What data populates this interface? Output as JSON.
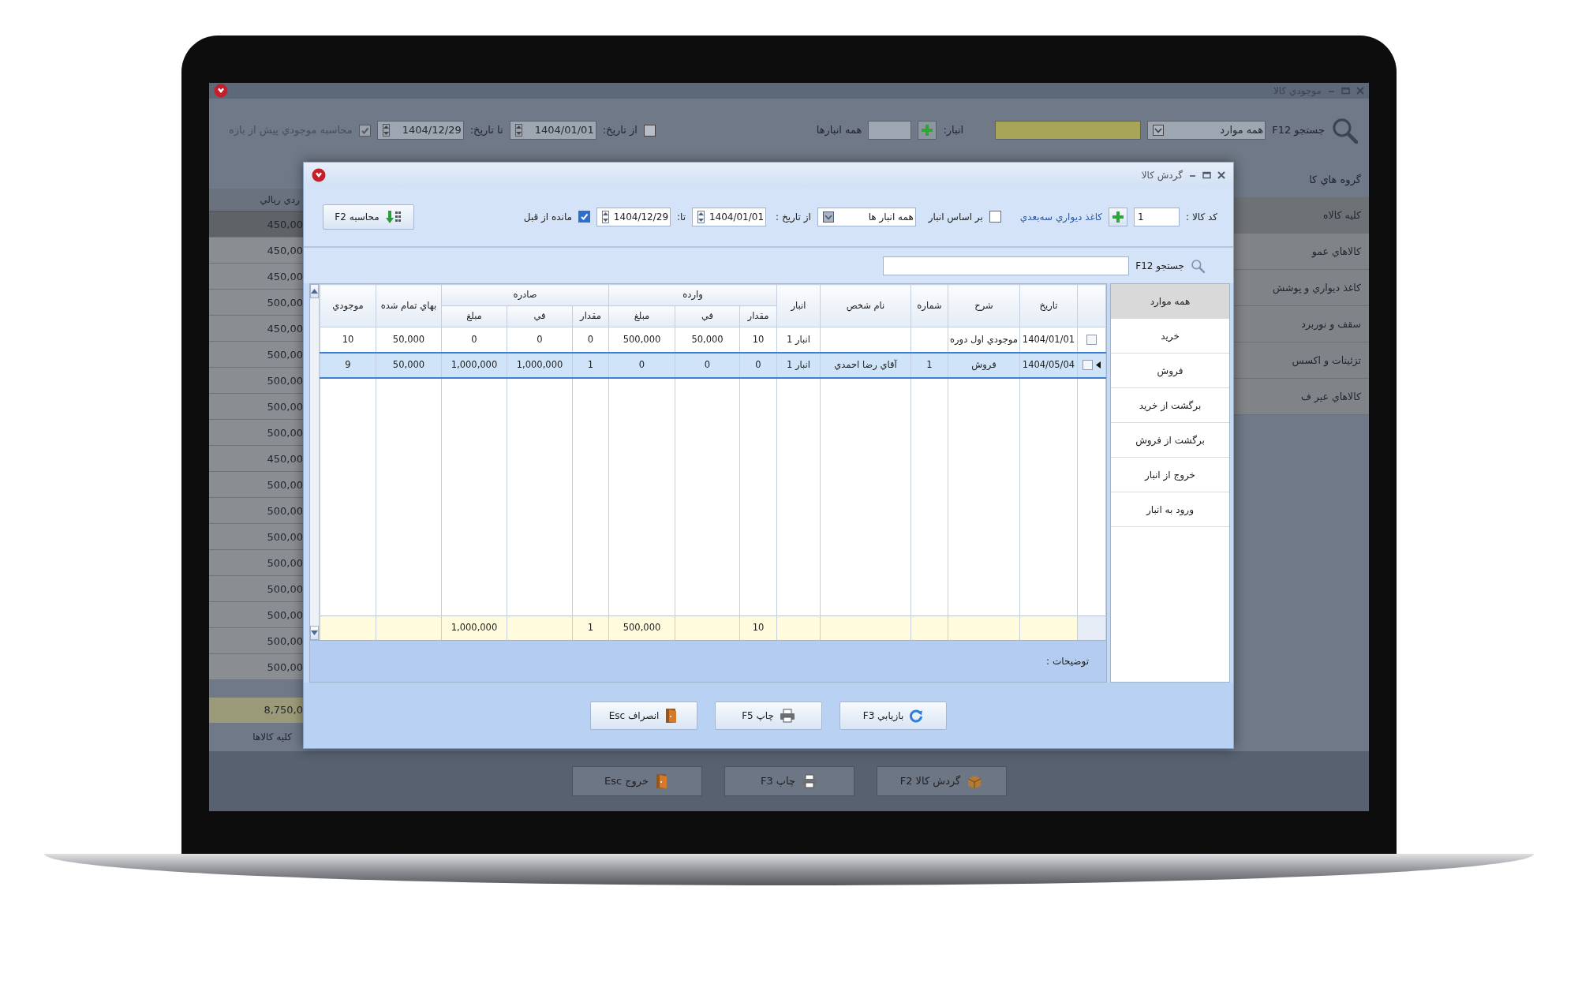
{
  "background_window": {
    "title": "موجودي كالا",
    "toolbar": {
      "search_label": "جستجو F12",
      "category": "همه موارد",
      "warehouse_label": "انبار:",
      "warehouse_name": "همه انبارها",
      "from_date_checked": false,
      "from_date_label": "از تاريخ:",
      "from_date": "1404/01/01",
      "to_date_label": "تا تاريخ:",
      "to_date": "1404/12/29",
      "prior_balance_checked": true,
      "prior_balance_label": "محاسبه موجودي پيش از بازه"
    },
    "value_column": {
      "header": "ردي ريالي",
      "rows": [
        {
          "value": "450,00",
          "selected": true
        },
        {
          "value": "450,00",
          "selected": false
        },
        {
          "value": "450,00",
          "selected": false
        },
        {
          "value": "500,00",
          "selected": false
        },
        {
          "value": "450,00",
          "selected": false
        },
        {
          "value": "500,00",
          "selected": false
        },
        {
          "value": "500,00",
          "selected": false
        },
        {
          "value": "500,00",
          "selected": false
        },
        {
          "value": "500,00",
          "selected": false
        },
        {
          "value": "450,00",
          "selected": false
        },
        {
          "value": "500,00",
          "selected": false
        },
        {
          "value": "500,00",
          "selected": false
        },
        {
          "value": "500,00",
          "selected": false
        },
        {
          "value": "500,00",
          "selected": false
        },
        {
          "value": "500,00",
          "selected": false
        },
        {
          "value": "500,00",
          "selected": false
        },
        {
          "value": "500,00",
          "selected": false
        },
        {
          "value": "500,00",
          "selected": false
        }
      ],
      "total": "8,750,0",
      "footer": "كليه كالاها"
    },
    "groups": {
      "header": "گروه هاي كا",
      "items": [
        {
          "label": "كليه كالاه",
          "selected": true
        },
        {
          "label": "كالاهاي عمو",
          "selected": false
        },
        {
          "label": "كاغذ ديواري و پوشش",
          "selected": false
        },
        {
          "label": "سقف و نوربرد",
          "selected": false
        },
        {
          "label": "تزئينات و اكسس",
          "selected": false
        },
        {
          "label": "كالاهاي عير ف",
          "selected": false
        }
      ]
    },
    "buttons": [
      {
        "label": "گردش كالا F2",
        "kind": "box"
      },
      {
        "label": "چاپ F3",
        "kind": "printer"
      },
      {
        "label": "خروج Esc",
        "kind": "door"
      }
    ]
  },
  "dialog": {
    "title": "گردش كالا",
    "filters": {
      "code_label": "كد كالا :",
      "code": "1",
      "product_name": "كاغذ ديواري سه‌بعدي",
      "by_warehouse_checked": false,
      "by_warehouse_label": "بر اساس انبار",
      "warehouse": "همه انبار ها",
      "from_label": "از تاريخ :",
      "from_date": "1404/01/01",
      "to_label": "تا:",
      "to_date": "1404/12/29",
      "carry_checked": true,
      "carry_label": "مانده از قبل",
      "calc_button": {
        "label": "محاسبه F2",
        "kind": "calc"
      }
    },
    "search_label": "جستجو F12",
    "columns": [
      {
        "label": "تاريخ"
      },
      {
        "label": "شرح"
      },
      {
        "label": "شماره"
      },
      {
        "label": "نام شخص"
      },
      {
        "label": "انبار"
      },
      {
        "label": "وارده",
        "colspan": 3,
        "children": [
          {
            "label": "مقدار"
          },
          {
            "label": "في"
          },
          {
            "label": "مبلغ"
          }
        ]
      },
      {
        "label": "صادره",
        "colspan": 3,
        "children": [
          {
            "label": "مقدار"
          },
          {
            "label": "في"
          },
          {
            "label": "مبلغ"
          }
        ]
      },
      {
        "label": "بهاي تمام شده"
      },
      {
        "label": "موجودي"
      }
    ],
    "rows": [
      {
        "kind": "entry",
        "checked": false,
        "selected": false,
        "cells": [
          "1404/01/01",
          "موجودي اول دوره",
          null,
          null,
          "انبار 1",
          "10",
          "50,000",
          "500,000",
          "0",
          "0",
          "0",
          "50,000",
          "10"
        ]
      },
      {
        "kind": "entry",
        "checked": false,
        "selected": true,
        "cells": [
          "1404/05/04",
          "فروش",
          "1",
          "آقاي رضا احمدي",
          "انبار 1",
          "0",
          "0",
          "0",
          "1",
          "1,000,000",
          "1,000,000",
          "50,000",
          "9"
        ]
      },
      {
        "kind": "total",
        "cells": [
          null,
          null,
          null,
          null,
          null,
          "10",
          null,
          "500,000",
          "1",
          null,
          "1,000,000",
          null,
          null
        ]
      }
    ],
    "description_label": "توضيحات :",
    "filter_list": [
      {
        "label": "همه موارد",
        "selected": true
      },
      {
        "label": "خريد",
        "selected": false
      },
      {
        "label": "فروش",
        "selected": false
      },
      {
        "label": "برگشت از خريد",
        "selected": false
      },
      {
        "label": "برگشت از فروش",
        "selected": false
      },
      {
        "label": "خروج از انبار",
        "selected": false
      },
      {
        "label": "ورود به انبار",
        "selected": false
      }
    ],
    "buttons": [
      {
        "label": "بازيابي F3",
        "kind": "refresh"
      },
      {
        "label": "چاپ F5",
        "kind": "printer"
      },
      {
        "label": "انصراف Esc",
        "kind": "door"
      }
    ]
  }
}
